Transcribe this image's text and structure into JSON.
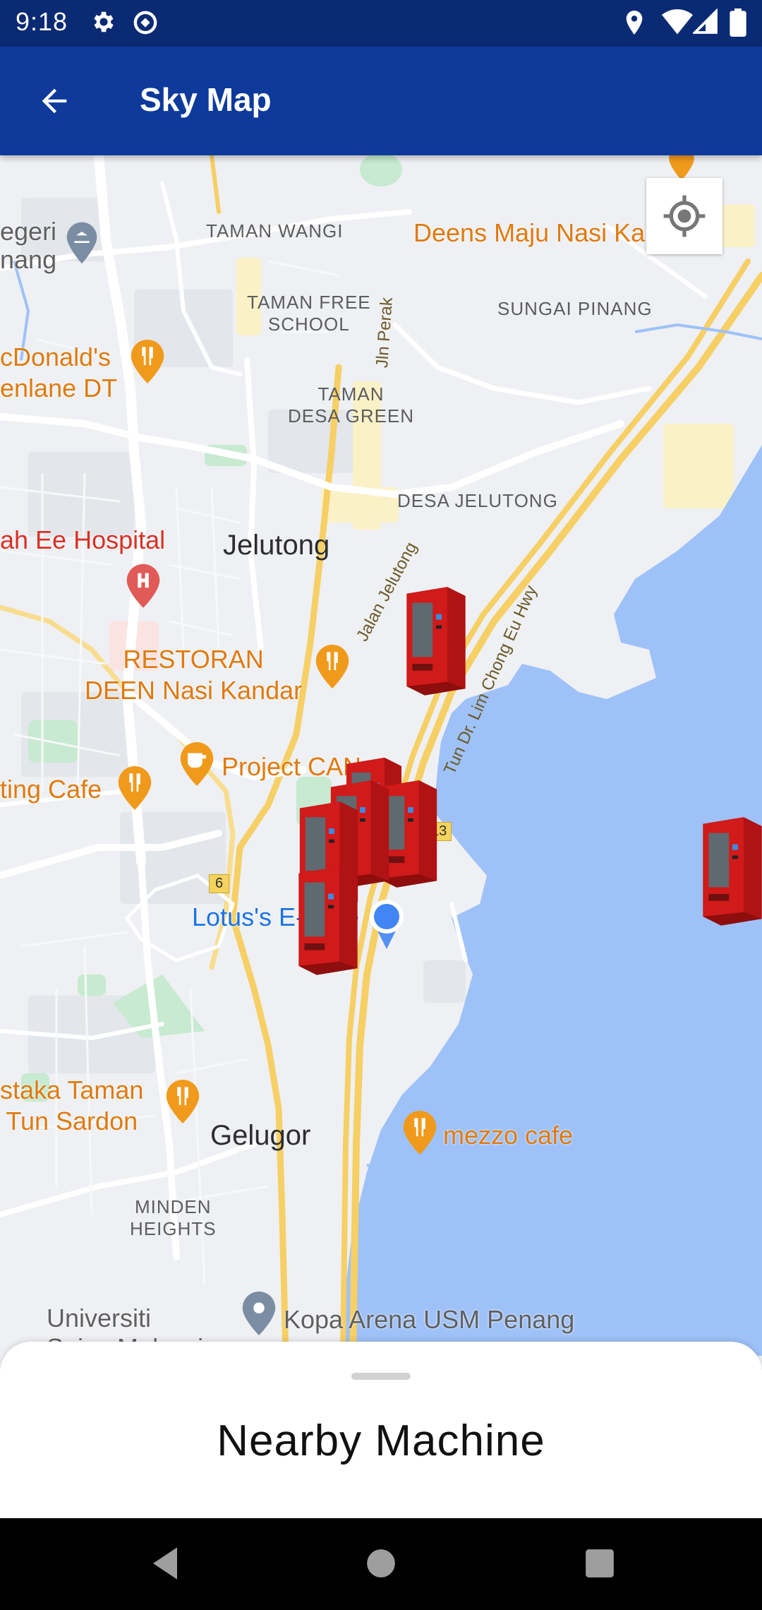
{
  "status_bar": {
    "time": "9:18",
    "left_icons": [
      "settings-icon",
      "data-saver-icon"
    ],
    "right_icons": [
      "location-icon",
      "wifi-icon",
      "signal-icon",
      "battery-icon"
    ]
  },
  "app_bar": {
    "title": "Sky Map",
    "back_icon": "arrow-back-icon",
    "background_color": "#0d3a9b"
  },
  "map": {
    "area_labels": [
      {
        "id": "taman-wangi",
        "text": "TAMAN WANGI"
      },
      {
        "id": "taman-free-school",
        "text": "TAMAN FREE\nSCHOOL"
      },
      {
        "id": "sungai-pinang",
        "text": "SUNGAI PINANG"
      },
      {
        "id": "taman-desa-green",
        "text": "TAMAN\nDESA GREEN"
      },
      {
        "id": "desa-jelutong",
        "text": "DESA JELUTONG"
      },
      {
        "id": "minden-heights",
        "text": "MINDEN\nHEIGHTS"
      }
    ],
    "towns": [
      "Jelutong",
      "Gelugor"
    ],
    "pois": [
      {
        "id": "negeri-pinang",
        "text": "egeri\nnang",
        "kind": "grey"
      },
      {
        "id": "deens-maju",
        "text": "Deens Maju Nasi Ka",
        "kind": "restaurant"
      },
      {
        "id": "mcdonalds",
        "text": "cDonald's\nenlane DT",
        "kind": "restaurant"
      },
      {
        "id": "hospital",
        "text": "ah Ee Hospital",
        "kind": "hospital"
      },
      {
        "id": "restoran-deen",
        "text": "RESTORAN\nDEEN Nasi Kandar",
        "kind": "restaurant"
      },
      {
        "id": "project-can",
        "text": "Project CAN",
        "kind": "cafe"
      },
      {
        "id": "ting-cafe",
        "text": "ting Cafe",
        "kind": "restaurant"
      },
      {
        "id": "lotus",
        "text": "Lotus's E-Gate",
        "kind": "shopping"
      },
      {
        "id": "pustaka",
        "text": "staka Taman\nTun Sardon",
        "kind": "restaurant"
      },
      {
        "id": "mezzo",
        "text": "mezzo cafe",
        "kind": "restaurant"
      },
      {
        "id": "universiti",
        "text": "Universiti\nSains Malaysia",
        "kind": "grey"
      },
      {
        "id": "kopa-arena",
        "text": "Kopa Arena USM Penang",
        "kind": "grey"
      }
    ],
    "road_labels": [
      "Jln Perak",
      "Jalan Jelutong",
      "Tun Dr. Lim Chong Eu Hwy"
    ],
    "route_shields": [
      "13",
      "6"
    ],
    "locate_button_icon": "my-location-icon",
    "marker_icon": "vending-machine-icon",
    "marker_color": "#d11a1a",
    "water_color": "#9ec1f8"
  },
  "bottom_sheet": {
    "title": "Nearby Machine"
  },
  "nav_bar": {
    "icons": [
      "nav-back-icon",
      "nav-home-icon",
      "nav-recents-icon"
    ]
  }
}
